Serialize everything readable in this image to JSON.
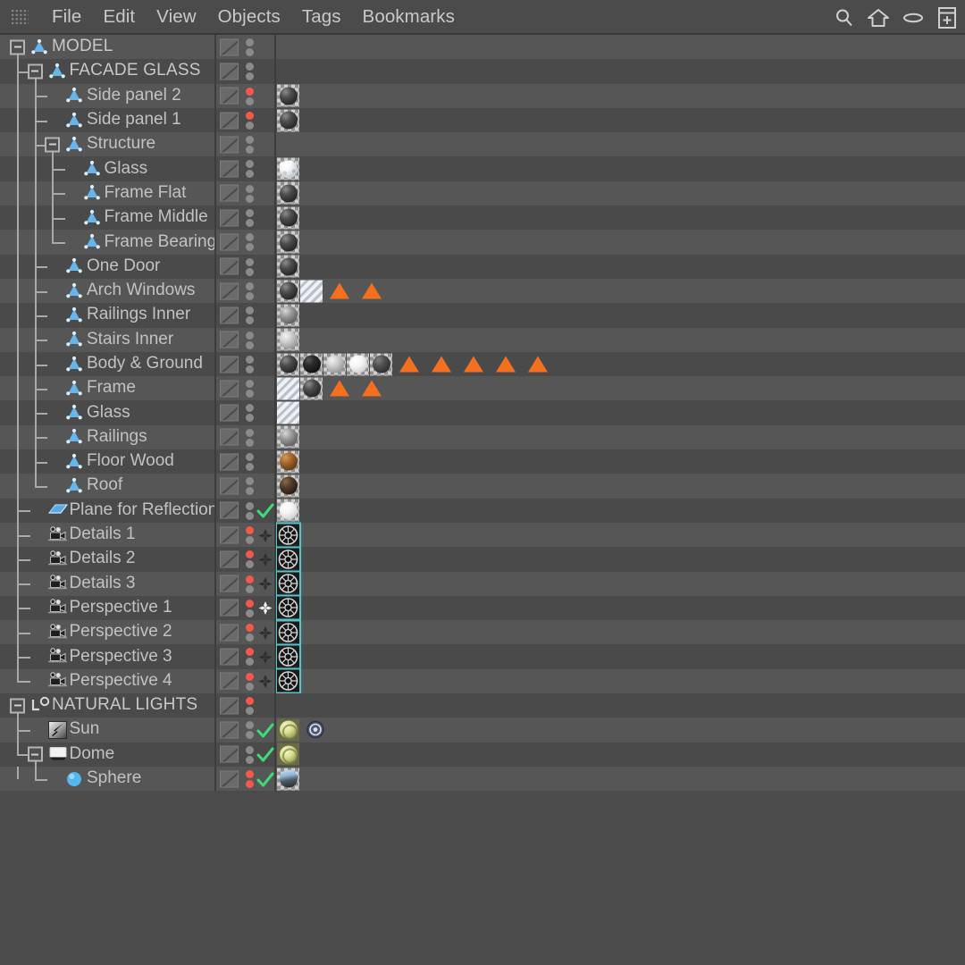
{
  "window": {
    "app": "Cinema 4D Object Manager",
    "grip_icon": "drag-grip-icon"
  },
  "menu": {
    "items": [
      {
        "label": "File"
      },
      {
        "label": "Edit"
      },
      {
        "label": "View"
      },
      {
        "label": "Objects"
      },
      {
        "label": "Tags"
      },
      {
        "label": "Bookmarks"
      }
    ],
    "right_icons": [
      {
        "name": "search-icon"
      },
      {
        "name": "home-icon"
      },
      {
        "name": "ellipse-icon"
      },
      {
        "name": "add-layer-icon"
      }
    ]
  },
  "colors": {
    "background": "#4b4b4b",
    "row_light": "#565656",
    "row_dark": "#4a4a4a",
    "text": "#c2c2c2",
    "accent_orange": "#f4701f",
    "accent_red": "#f2594b",
    "accent_green": "#4cd964",
    "accent_cyan": "#5fd8dc",
    "object_blue": "#69b4e8"
  },
  "tree": {
    "rows": [
      {
        "label": "MODEL",
        "depth": 0,
        "icon": "null-object-icon",
        "expander": true,
        "dot_top": "gray",
        "dot_bottom": "gray",
        "tags": []
      },
      {
        "label": "FACADE GLASS",
        "depth": 1,
        "icon": "null-object-icon",
        "expander": true,
        "dot_top": "gray",
        "dot_bottom": "gray",
        "tags": []
      },
      {
        "label": "Side panel 2",
        "depth": 2,
        "icon": "null-object-icon",
        "expander": false,
        "dot_top": "red",
        "dot_bottom": "gray",
        "tags": [
          "material-dark"
        ]
      },
      {
        "label": "Side panel 1",
        "depth": 2,
        "icon": "null-object-icon",
        "expander": false,
        "dot_top": "red",
        "dot_bottom": "gray",
        "tags": [
          "material-dark"
        ]
      },
      {
        "label": "Structure",
        "depth": 2,
        "icon": "null-object-icon",
        "expander": true,
        "dot_top": "gray",
        "dot_bottom": "gray",
        "tags": []
      },
      {
        "label": "Glass",
        "depth": 3,
        "icon": "null-object-icon",
        "expander": false,
        "dot_top": "gray",
        "dot_bottom": "gray",
        "tags": [
          "material-frost"
        ]
      },
      {
        "label": "Frame Flat",
        "depth": 3,
        "icon": "null-object-icon",
        "expander": false,
        "dot_top": "gray",
        "dot_bottom": "gray",
        "tags": [
          "material-dark"
        ]
      },
      {
        "label": "Frame Middle",
        "depth": 3,
        "icon": "null-object-icon",
        "expander": false,
        "dot_top": "gray",
        "dot_bottom": "gray",
        "tags": [
          "material-dark"
        ]
      },
      {
        "label": "Frame Bearing",
        "depth": 3,
        "icon": "null-object-icon",
        "expander": false,
        "dot_top": "gray",
        "dot_bottom": "gray",
        "tags": [
          "material-dark"
        ]
      },
      {
        "label": "One Door",
        "depth": 2,
        "icon": "null-object-icon",
        "expander": false,
        "dot_top": "gray",
        "dot_bottom": "gray",
        "tags": [
          "material-dark"
        ]
      },
      {
        "label": "Arch Windows",
        "depth": 2,
        "icon": "null-object-icon",
        "expander": false,
        "dot_top": "gray",
        "dot_bottom": "gray",
        "tags": [
          "material-dark",
          "material-glass",
          "selection-tag",
          "selection-tag"
        ]
      },
      {
        "label": "Railings Inner",
        "depth": 2,
        "icon": "null-object-icon",
        "expander": false,
        "dot_top": "gray",
        "dot_bottom": "gray",
        "tags": [
          "material-midgray"
        ]
      },
      {
        "label": "Stairs Inner",
        "depth": 2,
        "icon": "null-object-icon",
        "expander": false,
        "dot_top": "gray",
        "dot_bottom": "gray",
        "tags": [
          "material-lightgray"
        ]
      },
      {
        "label": "Body & Ground",
        "depth": 2,
        "icon": "null-object-icon",
        "expander": false,
        "dot_top": "gray",
        "dot_bottom": "gray",
        "tags": [
          "material-dark",
          "material-black",
          "material-lightgray",
          "material-white",
          "material-darkgray",
          "selection-tag",
          "selection-tag",
          "selection-tag",
          "selection-tag",
          "selection-tag"
        ]
      },
      {
        "label": "Frame",
        "depth": 2,
        "icon": "null-object-icon",
        "expander": false,
        "dot_top": "gray",
        "dot_bottom": "gray",
        "tags": [
          "material-glass",
          "material-dark",
          "selection-tag",
          "selection-tag"
        ]
      },
      {
        "label": "Glass",
        "depth": 2,
        "icon": "null-object-icon",
        "expander": false,
        "dot_top": "gray",
        "dot_bottom": "gray",
        "tags": [
          "material-glass"
        ]
      },
      {
        "label": "Railings",
        "depth": 2,
        "icon": "null-object-icon",
        "expander": false,
        "dot_top": "gray",
        "dot_bottom": "gray",
        "tags": [
          "material-midgray"
        ]
      },
      {
        "label": "Floor Wood",
        "depth": 2,
        "icon": "null-object-icon",
        "expander": false,
        "dot_top": "gray",
        "dot_bottom": "gray",
        "tags": [
          "material-wood"
        ]
      },
      {
        "label": "Roof",
        "depth": 2,
        "icon": "null-object-icon",
        "expander": false,
        "dot_top": "gray",
        "dot_bottom": "gray",
        "tags": [
          "material-darkbrown"
        ]
      },
      {
        "label": "Plane for Reflection",
        "depth": 1,
        "icon": "plane-object-icon",
        "expander": false,
        "dot_top": "gray",
        "dot_bottom": "gray",
        "check": true,
        "tags": [
          "material-white"
        ]
      },
      {
        "label": "Details 1",
        "depth": 1,
        "icon": "camera-object-icon",
        "expander": false,
        "dot_top": "red",
        "dot_bottom": "gray",
        "protection": "dim",
        "tags": [
          "camera-tag"
        ]
      },
      {
        "label": "Details 2",
        "depth": 1,
        "icon": "camera-object-icon",
        "expander": false,
        "dot_top": "red",
        "dot_bottom": "gray",
        "protection": "dim",
        "tags": [
          "camera-tag"
        ]
      },
      {
        "label": "Details 3",
        "depth": 1,
        "icon": "camera-object-icon",
        "expander": false,
        "dot_top": "red",
        "dot_bottom": "gray",
        "protection": "dim",
        "tags": [
          "camera-tag"
        ]
      },
      {
        "label": "Perspective 1",
        "depth": 1,
        "icon": "camera-object-icon",
        "expander": false,
        "dot_top": "red",
        "dot_bottom": "gray",
        "protection": "active",
        "tags": [
          "camera-tag"
        ]
      },
      {
        "label": "Perspective 2",
        "depth": 1,
        "icon": "camera-object-icon",
        "expander": false,
        "dot_top": "red",
        "dot_bottom": "gray",
        "protection": "dim",
        "tags": [
          "camera-tag"
        ]
      },
      {
        "label": "Perspective 3",
        "depth": 1,
        "icon": "camera-object-icon",
        "expander": false,
        "dot_top": "red",
        "dot_bottom": "gray",
        "protection": "dim",
        "tags": [
          "camera-tag"
        ]
      },
      {
        "label": "Perspective 4",
        "depth": 1,
        "icon": "camera-object-icon",
        "expander": false,
        "dot_top": "red",
        "dot_bottom": "gray",
        "protection": "dim",
        "tags": [
          "camera-tag"
        ]
      },
      {
        "label": "NATURAL LIGHTS",
        "depth": 0,
        "icon": "light-group-icon",
        "expander": true,
        "dot_top": "red",
        "dot_bottom": "gray",
        "tags": []
      },
      {
        "label": "Sun",
        "depth": 1,
        "icon": "infinite-light-icon",
        "expander": false,
        "dot_top": "gray",
        "dot_bottom": "gray",
        "check": true,
        "tags": [
          "light-material",
          "target-tag"
        ]
      },
      {
        "label": "Dome",
        "depth": 1,
        "icon": "sky-object-icon",
        "expander": true,
        "dot_top": "gray",
        "dot_bottom": "gray",
        "check": true,
        "tags": [
          "light-material"
        ]
      },
      {
        "label": "Sphere",
        "depth": 2,
        "icon": "sphere-object-icon",
        "expander": false,
        "dot_top": "red",
        "dot_bottom": "red",
        "check": true,
        "tags": [
          "material-sky"
        ]
      }
    ]
  }
}
